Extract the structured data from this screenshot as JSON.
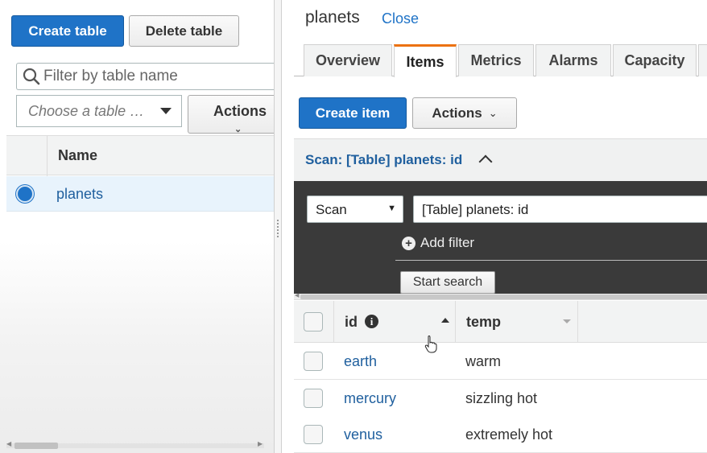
{
  "left": {
    "create_table": "Create table",
    "delete_table": "Delete table",
    "filter_placeholder": "Filter by table name",
    "choose_placeholder": "Choose a table …",
    "actions": "Actions",
    "column_name": "Name",
    "tables": [
      {
        "name": "planets",
        "selected": true
      }
    ]
  },
  "detail": {
    "table_name": "planets",
    "close": "Close",
    "tabs": [
      {
        "label": "Overview",
        "active": false
      },
      {
        "label": "Items",
        "active": true
      },
      {
        "label": "Metrics",
        "active": false
      },
      {
        "label": "Alarms",
        "active": false
      },
      {
        "label": "Capacity",
        "active": false
      }
    ],
    "create_item": "Create item",
    "actions": "Actions",
    "scan_header": "Scan: [Table] planets: id",
    "scan_mode": "Scan",
    "scan_target": "[Table] planets: id",
    "add_filter": "Add filter",
    "start_search": "Start search",
    "columns": {
      "id": "id",
      "temp": "temp"
    },
    "items": [
      {
        "id": "earth",
        "temp": "warm"
      },
      {
        "id": "mercury",
        "temp": "sizzling hot"
      },
      {
        "id": "venus",
        "temp": "extremely hot"
      }
    ]
  },
  "colors": {
    "primary": "#1f73c7",
    "link": "#1f5f9e",
    "active_tab_accent": "#ec7211",
    "scan_panel_bg": "#3a3a3a"
  },
  "icons": {
    "search": "search-icon",
    "info": "info-icon",
    "add": "plus-circle-icon"
  }
}
